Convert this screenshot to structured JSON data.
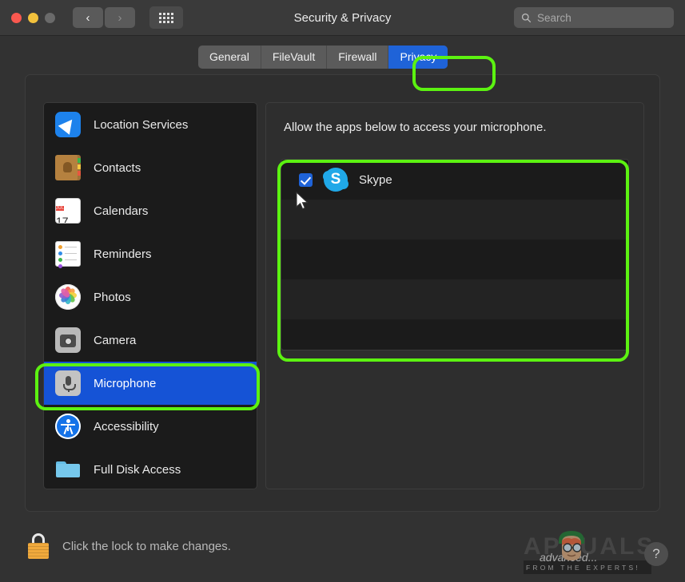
{
  "window": {
    "title": "Security & Privacy",
    "traffic_lights": [
      "close",
      "minimize",
      "zoom"
    ],
    "nav": {
      "back": "‹",
      "forward": "›"
    },
    "grid_button": "show-all-preferences"
  },
  "search": {
    "placeholder": "Search",
    "value": ""
  },
  "tabs": [
    {
      "label": "General",
      "active": false
    },
    {
      "label": "FileVault",
      "active": false
    },
    {
      "label": "Firewall",
      "active": false
    },
    {
      "label": "Privacy",
      "active": true
    }
  ],
  "sidebar": {
    "items": [
      {
        "label": "Location Services",
        "icon": "location-services-icon",
        "selected": false
      },
      {
        "label": "Contacts",
        "icon": "contacts-icon",
        "selected": false
      },
      {
        "label": "Calendars",
        "icon": "calendars-icon",
        "selected": false
      },
      {
        "label": "Reminders",
        "icon": "reminders-icon",
        "selected": false
      },
      {
        "label": "Photos",
        "icon": "photos-icon",
        "selected": false
      },
      {
        "label": "Camera",
        "icon": "camera-icon",
        "selected": false
      },
      {
        "label": "Microphone",
        "icon": "microphone-icon",
        "selected": true
      },
      {
        "label": "Accessibility",
        "icon": "accessibility-icon",
        "selected": false
      },
      {
        "label": "Full Disk Access",
        "icon": "folder-icon",
        "selected": false
      }
    ]
  },
  "calendar_icon": {
    "month": "JUL",
    "day": "17"
  },
  "right_pane": {
    "description": "Allow the apps below to access your microphone.",
    "apps": [
      {
        "name": "Skype",
        "checked": true,
        "icon": "skype-icon"
      }
    ]
  },
  "footer": {
    "lock_message": "Click the lock to make changes.",
    "lock_state": "unlocked",
    "help_label": "?"
  },
  "watermark": {
    "brand": "APPUALS",
    "tagline": "FROM THE EXPERTS!",
    "mid_text": "advanced..."
  },
  "annotations": [
    {
      "target": "privacy-tab",
      "color": "#5cf211"
    },
    {
      "target": "app-list",
      "color": "#5cf211"
    },
    {
      "target": "microphone-sidebar-item",
      "color": "#5cf211"
    }
  ],
  "colors": {
    "accent_blue": "#1f63d8",
    "selection_blue": "#1553d6",
    "annotation_green": "#5cf211",
    "window_bg": "#323232",
    "panel_bg": "#2e2e2e",
    "list_bg": "#1b1b1b"
  }
}
